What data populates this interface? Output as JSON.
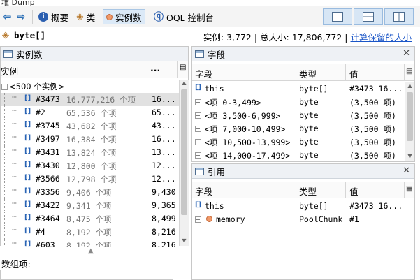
{
  "window": {
    "title": "堆 Dump"
  },
  "toolbar": {
    "back_icon": "arrow-left-icon",
    "forward_icon": "arrow-right-icon",
    "summary": "概要",
    "classes": "类",
    "instances": "实例数",
    "oql": "OQL 控制台"
  },
  "info": {
    "class_name": "byte[]",
    "instances_label": "实例:",
    "instances_value": "3,772",
    "size_label": "总大小:",
    "size_value": "17,806,772",
    "retained_link": "计算保留的大小"
  },
  "instances_panel": {
    "title": "实例数",
    "col_instance": "实例",
    "col_size": "...",
    "root_label": "<500 个实例>",
    "rows": [
      {
        "id": "#3473",
        "count": "16,777,216 个项",
        "size": "16...",
        "selected": true
      },
      {
        "id": "#2",
        "count": "65,536 个项",
        "size": "65..."
      },
      {
        "id": "#3745",
        "count": "43,682 个项",
        "size": "43..."
      },
      {
        "id": "#3497",
        "count": "16,384 个项",
        "size": "16..."
      },
      {
        "id": "#3431",
        "count": "13,824 个项",
        "size": "13..."
      },
      {
        "id": "#3430",
        "count": "12,800 个项",
        "size": "12..."
      },
      {
        "id": "#3566",
        "count": "12,798 个项",
        "size": "12..."
      },
      {
        "id": "#3356",
        "count": "9,406 个项",
        "size": "9,430"
      },
      {
        "id": "#3422",
        "count": "9,341 个项",
        "size": "9,365"
      },
      {
        "id": "#3464",
        "count": "8,475 个项",
        "size": "8,499"
      },
      {
        "id": "#4",
        "count": "8,192 个项",
        "size": "8,216"
      },
      {
        "id": "#603",
        "count": "8,192 个项",
        "size": "8,216"
      }
    ]
  },
  "array_items": {
    "label": "数组项:"
  },
  "fields_panel": {
    "title": "字段",
    "col_field": "字段",
    "col_type": "类型",
    "col_value": "值",
    "rows": [
      {
        "name": "this",
        "type": "byte[]",
        "value": "#3473  16...",
        "kind": "this"
      },
      {
        "name": "<项 0-3,499>",
        "type": "byte",
        "value": "(3,500 项)",
        "kind": "range"
      },
      {
        "name": "<项 3,500-6,999>",
        "type": "byte",
        "value": "(3,500 项)",
        "kind": "range"
      },
      {
        "name": "<项 7,000-10,499>",
        "type": "byte",
        "value": "(3,500 项)",
        "kind": "range"
      },
      {
        "name": "<项 10,500-13,999>",
        "type": "byte",
        "value": "(3,500 项)",
        "kind": "range"
      },
      {
        "name": "<项 14,000-17,499>",
        "type": "byte",
        "value": "(3,500 项)",
        "kind": "range"
      }
    ]
  },
  "refs_panel": {
    "title": "引用",
    "col_field": "字段",
    "col_type": "类型",
    "col_value": "值",
    "rows": [
      {
        "name": "this",
        "type": "byte[]",
        "value": "#3473  16...",
        "kind": "this"
      },
      {
        "name": "memory",
        "type": "PoolChunk",
        "value": "#1",
        "kind": "object"
      }
    ]
  },
  "colors": {
    "link": "#1a55c7",
    "selected_row": "#e1e1e1",
    "panel_header": "#eef1f5"
  }
}
